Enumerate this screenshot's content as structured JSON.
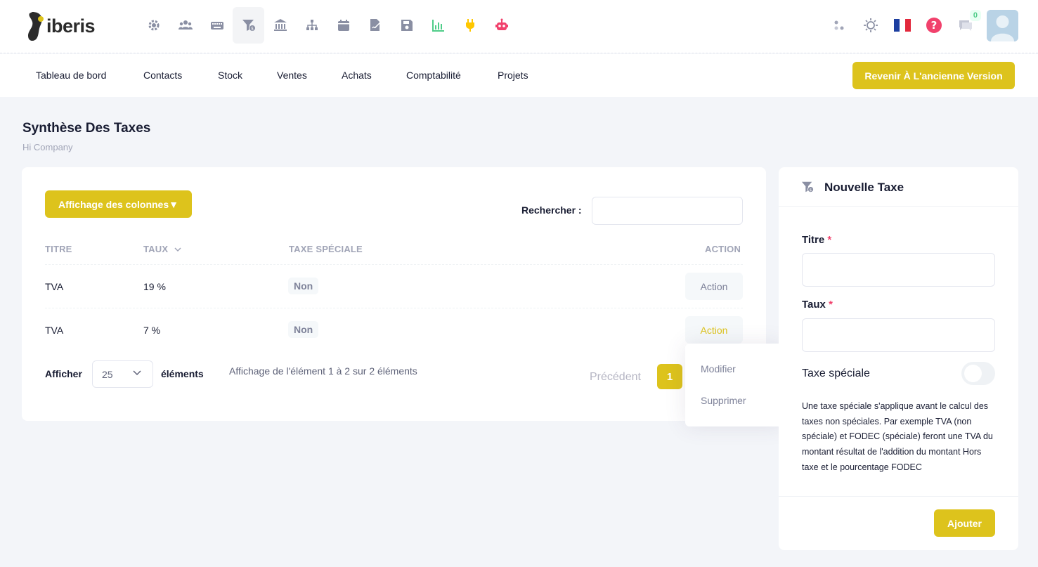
{
  "app": {
    "logo_text": "iberis",
    "brand_color": "#ddc31c",
    "modules": [
      {
        "icon": "gear-icon"
      },
      {
        "icon": "users-icon"
      },
      {
        "icon": "keyboard-icon"
      },
      {
        "icon": "tax-filter-icon",
        "active": true
      },
      {
        "icon": "bank-icon"
      },
      {
        "icon": "sitemap-icon"
      },
      {
        "icon": "calendar-icon"
      },
      {
        "icon": "signature-icon"
      },
      {
        "icon": "save-icon"
      },
      {
        "icon": "chart-icon"
      },
      {
        "icon": "plug-icon"
      },
      {
        "icon": "robot-icon"
      }
    ],
    "notifications_count": "0"
  },
  "nav": {
    "items": [
      "Tableau de bord",
      "Contacts",
      "Stock",
      "Ventes",
      "Achats",
      "Comptabilité",
      "Projets"
    ],
    "old_version_label": "Revenir À L'ancienne Version"
  },
  "page": {
    "title": "Synthèse Des Taxes",
    "subtitle": "Hi Company"
  },
  "table": {
    "columns_button": "Affichage des colonnes▼",
    "search_label": "Rechercher :",
    "search_value": "",
    "headers": [
      "TITRE",
      "TAUX",
      "TAXE SPÉCIALE",
      "ACTION"
    ],
    "rows": [
      {
        "titre": "TVA",
        "taux": "19 %",
        "speciale": "Non",
        "action": "Action"
      },
      {
        "titre": "TVA",
        "taux": "7 %",
        "speciale": "Non",
        "action": "Action"
      }
    ],
    "show_label": "Afficher",
    "page_length": "25",
    "elements_label": "éléments",
    "info": "Affichage de l'élément 1 à 2 sur 2 éléments",
    "prev_label": "Précédent",
    "current_page": "1"
  },
  "dropdown": {
    "items": [
      "Modifier",
      "Supprimer"
    ]
  },
  "form": {
    "title": "Nouvelle Taxe",
    "titre_label": "Titre",
    "taux_label": "Taux",
    "required_mark": "*",
    "special_label": "Taxe spéciale",
    "special_value": false,
    "help": "Une taxe spéciale s'applique avant le calcul des taxes non spéciales. Par exemple TVA (non spéciale) et FODEC (spéciale) feront une TVA du montant résultat de l'addition du montant Hors taxe et le pourcentage FODEC",
    "submit_label": "Ajouter"
  }
}
